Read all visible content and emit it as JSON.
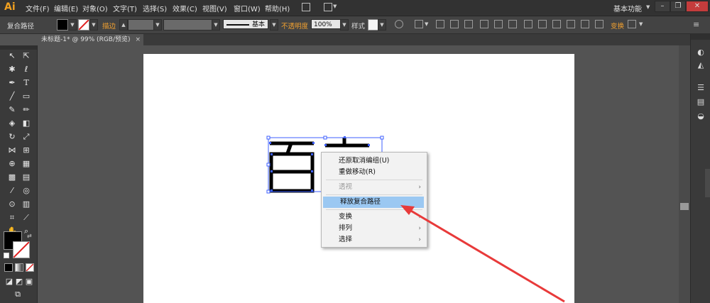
{
  "app": {
    "logo": "Ai",
    "menus": [
      "文件(F)",
      "编辑(E)",
      "对象(O)",
      "文字(T)",
      "选择(S)",
      "效果(C)",
      "视图(V)",
      "窗口(W)",
      "帮助(H)"
    ],
    "workspace": "基本功能"
  },
  "control_bar": {
    "selection_label": "复合路径",
    "stroke_label": "描边",
    "stroke_style": "基本",
    "opacity_label": "不透明度",
    "opacity_value": "100%",
    "style_label": "样式",
    "transform_label": "变换"
  },
  "document_tab": {
    "title": "未标题-1* @ 99% (RGB/预览)"
  },
  "context_menu": {
    "undo": "还原取消编组(U)",
    "redo": "重做移动(R)",
    "perspective": "透视",
    "release_compound_path": "释放复合路径",
    "transform": "变换",
    "arrange": "排列",
    "select": "选择"
  },
  "colors": {
    "accent_orange": "#f0a030",
    "highlight": "#9bc8f2",
    "annotation_red": "#e83a3a"
  }
}
